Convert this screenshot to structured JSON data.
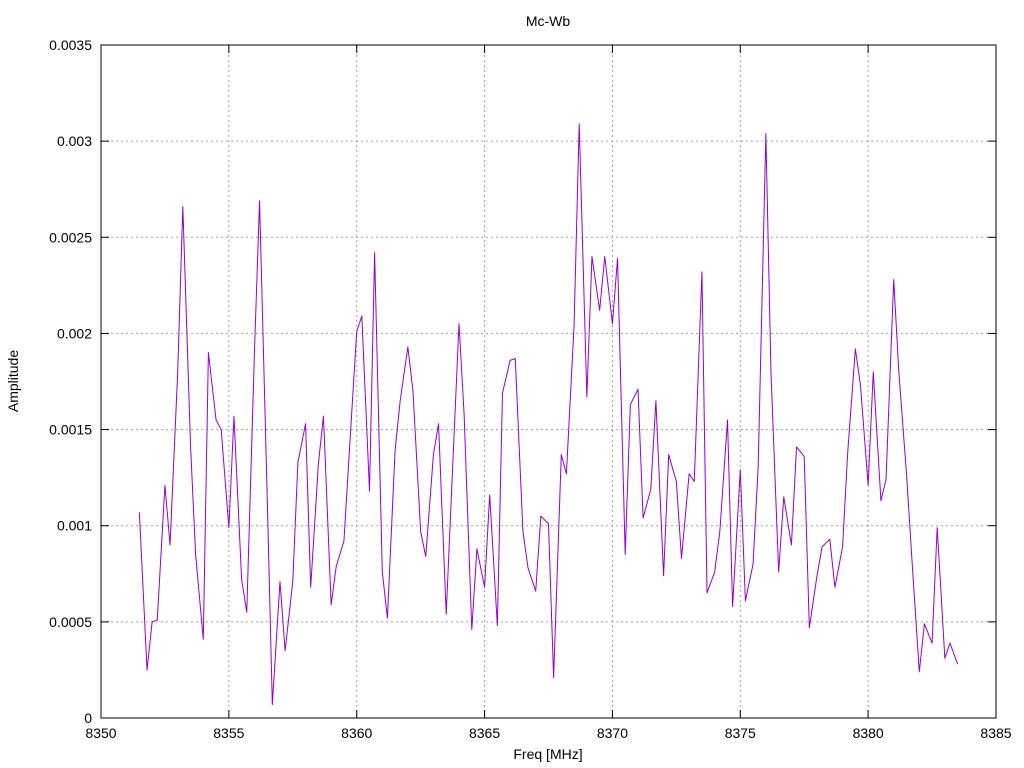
{
  "chart_data": {
    "type": "line",
    "title": "Mc-Wb",
    "xlabel": "Freq [MHz]",
    "ylabel": "Amplitude",
    "xlim": [
      8350,
      8385
    ],
    "ylim": [
      0,
      0.0035
    ],
    "xticks": [
      8350,
      8355,
      8360,
      8365,
      8370,
      8375,
      8380,
      8385
    ],
    "yticks": [
      0,
      0.0005,
      0.001,
      0.0015,
      0.002,
      0.0025,
      0.003,
      0.0035
    ],
    "xtick_labels": [
      "8350",
      "8355",
      "8360",
      "8365",
      "8370",
      "8375",
      "8380",
      "8385"
    ],
    "ytick_labels": [
      "0",
      "0.0005",
      "0.001",
      "0.0015",
      "0.002",
      "0.0025",
      "0.003",
      "0.0035"
    ],
    "grid": true,
    "series_color": "#9400d3",
    "series": [
      {
        "x": [
          8351.5,
          8351.8,
          8352.0,
          8352.2,
          8352.5,
          8352.7,
          8353.0,
          8353.2,
          8353.5,
          8353.7,
          8354.0,
          8354.2,
          8354.5,
          8354.7,
          8355.0,
          8355.2,
          8355.5,
          8355.7,
          8356.0,
          8356.2,
          8356.5,
          8356.7,
          8357.0,
          8357.2,
          8357.5,
          8357.7,
          8358.0,
          8358.2,
          8358.5,
          8358.7,
          8359.0,
          8359.2,
          8359.5,
          8359.7,
          8360.0,
          8360.2,
          8360.5,
          8360.7,
          8361.0,
          8361.2,
          8361.5,
          8361.7,
          8362.0,
          8362.2,
          8362.5,
          8362.7,
          8363.0,
          8363.2,
          8363.5,
          8363.7,
          8364.0,
          8364.2,
          8364.5,
          8364.7,
          8365.0,
          8365.2,
          8365.5,
          8365.7,
          8366.0,
          8366.2,
          8366.5,
          8366.7,
          8367.0,
          8367.2,
          8367.5,
          8367.7,
          8368.0,
          8368.2,
          8368.5,
          8368.7,
          8369.0,
          8369.2,
          8369.5,
          8369.7,
          8370.0,
          8370.2,
          8370.5,
          8370.7,
          8371.0,
          8371.2,
          8371.5,
          8371.7,
          8372.0,
          8372.2,
          8372.5,
          8372.7,
          8373.0,
          8373.2,
          8373.5,
          8373.7,
          8374.0,
          8374.2,
          8374.5,
          8374.7,
          8375.0,
          8375.2,
          8375.5,
          8375.7,
          8376.0,
          8376.2,
          8376.5,
          8376.7,
          8377.0,
          8377.2,
          8377.5,
          8377.7,
          8378.0,
          8378.2,
          8378.5,
          8378.7,
          8379.0,
          8379.2,
          8379.5,
          8379.7,
          8380.0,
          8380.2,
          8380.5,
          8380.7,
          8381.0,
          8381.2,
          8381.5,
          8381.7,
          8382.0,
          8382.2,
          8382.5,
          8382.7,
          8383.0,
          8383.2,
          8383.5
        ],
        "y": [
          0.00107,
          0.00025,
          0.0005,
          0.00051,
          0.00121,
          0.0009,
          0.0018,
          0.00266,
          0.00142,
          0.00085,
          0.00041,
          0.0019,
          0.00155,
          0.0015,
          0.00099,
          0.00157,
          0.00072,
          0.00055,
          0.0019,
          0.00269,
          0.00115,
          7e-05,
          0.00071,
          0.00035,
          0.00071,
          0.00133,
          0.00153,
          0.00068,
          0.00132,
          0.00157,
          0.00059,
          0.00079,
          0.00092,
          0.00136,
          0.00201,
          0.00209,
          0.00118,
          0.00242,
          0.00076,
          0.00052,
          0.00139,
          0.00165,
          0.00193,
          0.0017,
          0.00097,
          0.00084,
          0.00137,
          0.00153,
          0.00054,
          0.00115,
          0.00205,
          0.00158,
          0.00046,
          0.00088,
          0.00068,
          0.00116,
          0.00048,
          0.00169,
          0.00186,
          0.00187,
          0.00097,
          0.00078,
          0.00066,
          0.00105,
          0.00101,
          0.00021,
          0.00137,
          0.00127,
          0.00204,
          0.00309,
          0.00167,
          0.0024,
          0.00212,
          0.0024,
          0.00205,
          0.00239,
          0.00085,
          0.00163,
          0.00171,
          0.00104,
          0.00119,
          0.00165,
          0.00074,
          0.00137,
          0.00123,
          0.00083,
          0.00127,
          0.00123,
          0.00232,
          0.00065,
          0.00076,
          0.00097,
          0.00155,
          0.00058,
          0.00129,
          0.00061,
          0.0008,
          0.00131,
          0.00304,
          0.0018,
          0.00076,
          0.00115,
          0.0009,
          0.00141,
          0.00136,
          0.00047,
          0.00074,
          0.00089,
          0.00093,
          0.00068,
          0.00089,
          0.00138,
          0.00192,
          0.00173,
          0.00121,
          0.0018,
          0.00113,
          0.00124,
          0.00228,
          0.0018,
          0.00127,
          0.00085,
          0.00024,
          0.00049,
          0.00039,
          0.00099,
          0.00031,
          0.00039,
          0.00028
        ]
      }
    ]
  }
}
